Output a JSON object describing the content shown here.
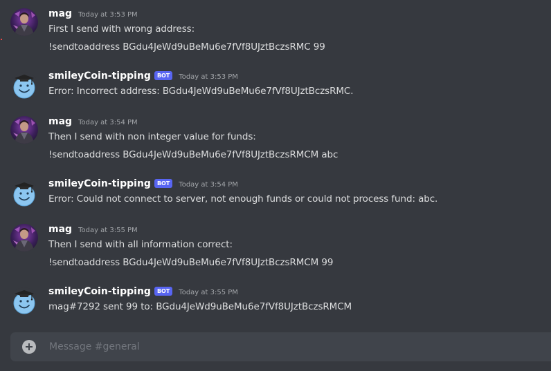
{
  "colors": {
    "background": "#36393f",
    "composer_background": "#40444b",
    "bot_tag": "#5865f2",
    "username": "#ffffff",
    "timestamp": "#a3a6aa",
    "message_text": "#dcddde"
  },
  "messages": [
    {
      "author": "mag",
      "avatar": "mag-avatar",
      "timestamp": "Today at 3:53 PM",
      "lines": [
        "First I send with wrong address:",
        "!sendtoaddress BGdu4JeWd9uBeMu6e7fVf8UJztBczsRMC 99"
      ]
    },
    {
      "author": "smileyCoin-tipping",
      "bot_tag": "BOT",
      "avatar": "smiley-bot-avatar",
      "timestamp": "Today at 3:53 PM",
      "lines": [
        "Error: Incorrect address: BGdu4JeWd9uBeMu6e7fVf8UJztBczsRMC."
      ]
    },
    {
      "author": "mag",
      "avatar": "mag-avatar",
      "timestamp": "Today at 3:54 PM",
      "lines": [
        "Then I send with non integer value for funds:",
        "!sendtoaddress BGdu4JeWd9uBeMu6e7fVf8UJztBczsRMCM abc"
      ]
    },
    {
      "author": "smileyCoin-tipping",
      "bot_tag": "BOT",
      "avatar": "smiley-bot-avatar",
      "timestamp": "Today at 3:54 PM",
      "lines": [
        "Error: Could not connect to server, not enough funds or could not process fund: abc."
      ]
    },
    {
      "author": "mag",
      "avatar": "mag-avatar",
      "timestamp": "Today at 3:55 PM",
      "lines": [
        "Then I send with all information correct:",
        "!sendtoaddress BGdu4JeWd9uBeMu6e7fVf8UJztBczsRMCM 99"
      ]
    },
    {
      "author": "smileyCoin-tipping",
      "bot_tag": "BOT",
      "avatar": "smiley-bot-avatar",
      "timestamp": "Today at 3:55 PM",
      "lines": [
        "mag#7292 sent 99 to: BGdu4JeWd9uBeMu6e7fVf8UJztBczsRMCM"
      ]
    }
  ],
  "composer": {
    "placeholder": "Message #general",
    "add_icon": "plus-circle-icon"
  }
}
